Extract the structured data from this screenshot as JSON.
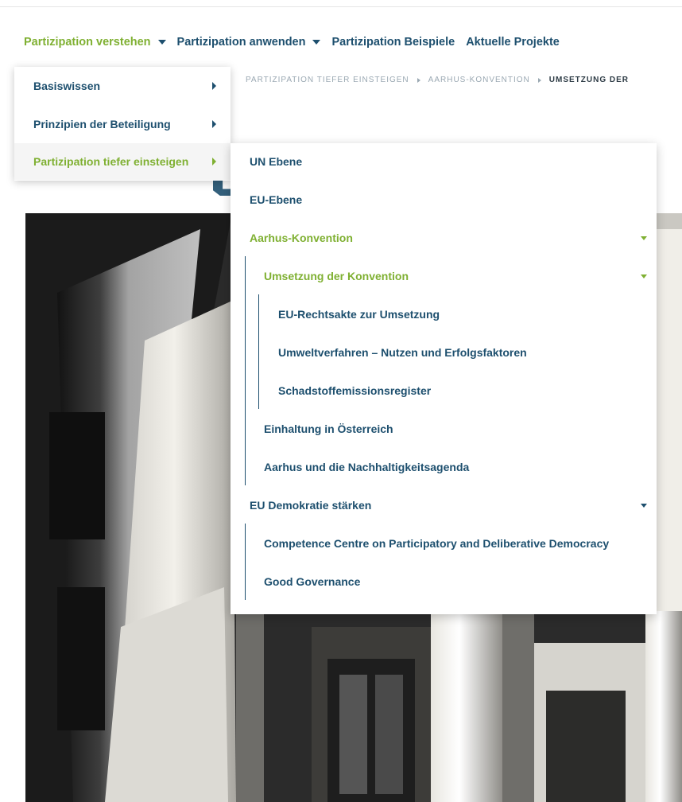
{
  "main_nav": [
    {
      "label": "Partizipation verstehen",
      "active": true,
      "has_caret": true
    },
    {
      "label": "Partizipation anwenden",
      "active": false,
      "has_caret": true
    },
    {
      "label": "Partizipation Beispiele",
      "active": false,
      "has_caret": false
    },
    {
      "label": "Aktuelle Projekte",
      "active": false,
      "has_caret": false
    }
  ],
  "breadcrumb": {
    "items": [
      "PARTIZIPATION TIEFER EINSTEIGEN",
      "AARHUS-KONVENTION"
    ],
    "current": "UMSETZUNG DER"
  },
  "submenu_level1": [
    {
      "label": "Basiswissen",
      "active": false
    },
    {
      "label": "Prinzipien der Beteiligung",
      "active": false
    },
    {
      "label": "Partizipation tiefer einsteigen",
      "active": true
    }
  ],
  "submenu_level2": {
    "un_ebene": "UN Ebene",
    "eu_ebene": "EU-Ebene",
    "aarhus": "Aarhus-Konvention",
    "umsetzung": "Umsetzung der Konvention",
    "eu_rechtsakte": "EU-Rechtsakte zur Umsetzung",
    "umweltverfahren": "Umweltverfahren – Nutzen und Erfolgsfaktoren",
    "schadstoff": "Schadstoffemissionsregister",
    "einhaltung": "Einhaltung in Österreich",
    "aarhus_agenda": "Aarhus und die Nachhaltigkeitsagenda",
    "eu_demokratie": "EU Demokratie stärken",
    "competence": "Competence Centre on Participatory and Deliberative Democracy",
    "good_governance": "Good Governance"
  },
  "colors": {
    "navy": "#1d4f6e",
    "green": "#7fb032",
    "breadcrumb_gray": "#9aa8b2"
  },
  "icons": [
    "chevron-down-icon",
    "chevron-right-icon"
  ]
}
